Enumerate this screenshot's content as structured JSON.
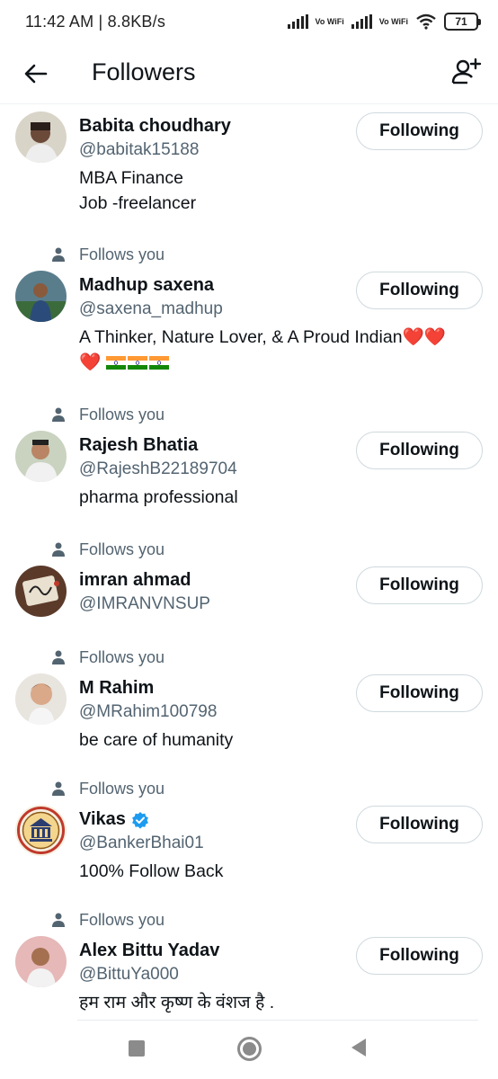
{
  "status_bar": {
    "time_speed": "11:42 AM | 8.8KB/s",
    "vowifi_1": "Vo WiFi",
    "vowifi_2": "Vo WiFi",
    "battery": "71"
  },
  "header": {
    "title": "Followers",
    "back_icon": "arrow-left-icon",
    "add_icon": "add-user-icon"
  },
  "follows_you_label": "Follows you",
  "button_label": "Following",
  "users": [
    {
      "name": "Babita choudhary",
      "handle": "@babitak15188",
      "bio_lines": [
        "MBA Finance",
        "Job -freelancer"
      ],
      "follows_you": false
    },
    {
      "name": "Madhup saxena",
      "handle": "@saxena_madhup",
      "bio_lines": [
        "A Thinker, Nature Lover, & A Proud Indian"
      ],
      "follows_you": true
    },
    {
      "name": "Rajesh Bhatia",
      "handle": "@RajeshB22189704",
      "bio_lines": [
        "pharma professional"
      ],
      "follows_you": true
    },
    {
      "name": "imran ahmad",
      "handle": "@IMRANVNSUP",
      "bio_lines": [],
      "follows_you": true
    },
    {
      "name": "M Rahim",
      "handle": "@MRahim100798",
      "bio_lines": [
        "be care of humanity"
      ],
      "follows_you": true
    },
    {
      "name": "Vikas",
      "handle": "@BankerBhai01",
      "bio_lines": [
        "100% Follow Back"
      ],
      "follows_you": true,
      "verified": true
    },
    {
      "name": "Alex Bittu Yadav",
      "handle": "@BittuYa000",
      "bio_lines": [
        "हम राम और कृष्ण के वंशज है ."
      ],
      "follows_you": true
    }
  ],
  "colors": {
    "text": "#0f1419",
    "secondary": "#536471",
    "border": "#cfd9de",
    "verified": "#1d9bf0",
    "heart": "#e0245e"
  }
}
